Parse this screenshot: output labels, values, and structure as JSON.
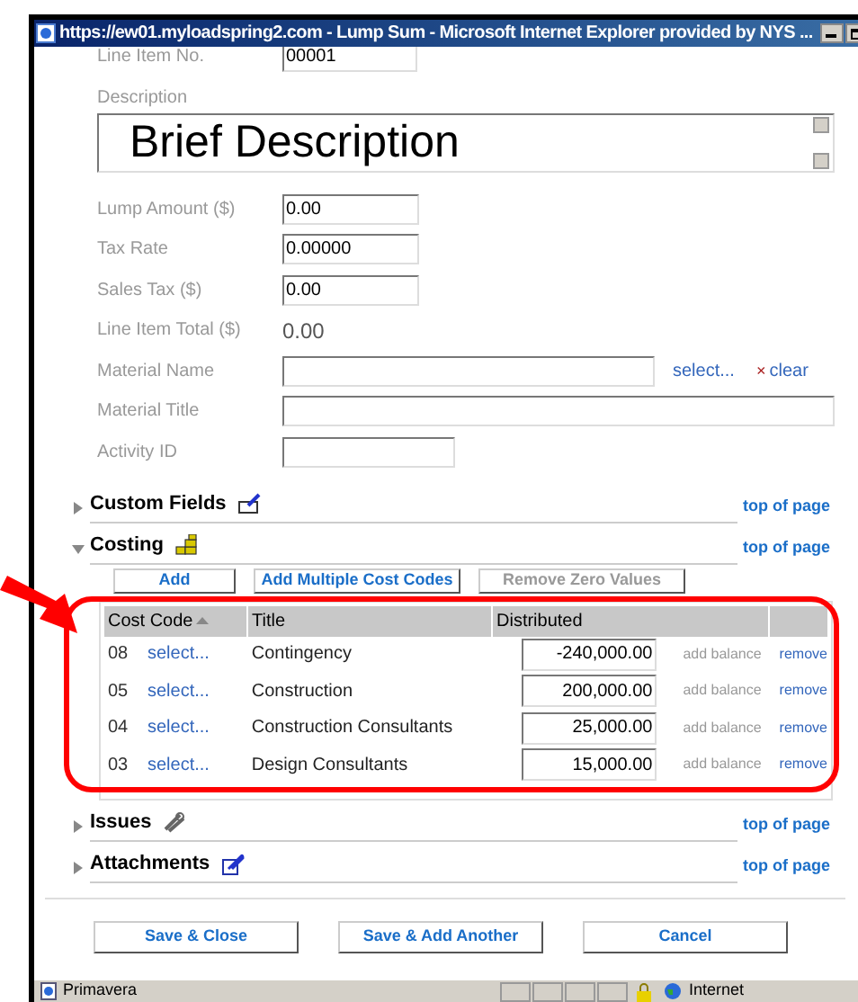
{
  "window": {
    "title": "https://ew01.myloadspring2.com - Lump Sum - Microsoft Internet Explorer provided by NYS ..."
  },
  "line_item": {
    "label": "Line Item No.",
    "value": "00001"
  },
  "description": {
    "label": "Description",
    "value": "Brief Description"
  },
  "fields": [
    {
      "kind": "input",
      "label": "Lump Amount ($)",
      "value": "0.00"
    },
    {
      "kind": "input",
      "label": "Tax Rate",
      "value": "0.00000"
    },
    {
      "kind": "input",
      "label": "Sales Tax ($)",
      "value": "0.00"
    },
    {
      "kind": "text",
      "label": "Line Item Total ($)",
      "value": "0.00"
    },
    {
      "kind": "lookup",
      "label": "Material Name",
      "select": "select...",
      "clear_icon": "×",
      "clear": "clear"
    },
    {
      "kind": "input",
      "label": "Material Title"
    },
    {
      "kind": "input",
      "label": "Activity ID"
    }
  ],
  "sections": [
    {
      "title": "Custom Fields",
      "expanded": false,
      "link": "top of page"
    },
    {
      "title": "Costing",
      "expanded": true,
      "link": "top of page"
    },
    {
      "title": "Issues",
      "expanded": false,
      "link": "top of page"
    },
    {
      "title": "Attachments",
      "expanded": false,
      "link": "top of page"
    }
  ],
  "costing": {
    "buttons": [
      {
        "label": "Add",
        "disabled": false
      },
      {
        "label": "Add Multiple Cost Codes",
        "disabled": false
      },
      {
        "label": "Remove Zero Values",
        "disabled": true
      }
    ],
    "columns": [
      {
        "label": "Cost Code",
        "sorted": true
      },
      {
        "label": "Title",
        "sorted": false
      },
      {
        "label": "Distributed",
        "sorted": false
      }
    ],
    "rows": [
      {
        "code": "08",
        "select": "select...",
        "title": "Contingency",
        "distributed": "-240,000.00",
        "add_balance": "add balance",
        "remove": "remove"
      },
      {
        "code": "05",
        "select": "select...",
        "title": "Construction",
        "distributed": "200,000.00",
        "add_balance": "add balance",
        "remove": "remove"
      },
      {
        "code": "04",
        "select": "select...",
        "title": "Construction Consultants",
        "distributed": "25,000.00",
        "add_balance": "add balance",
        "remove": "remove"
      },
      {
        "code": "03",
        "select": "select...",
        "title": "Design Consultants",
        "distributed": "15,000.00",
        "add_balance": "add balance",
        "remove": "remove"
      }
    ]
  },
  "footer_buttons": [
    "Save & Close",
    "Save & Add Another",
    "Cancel"
  ],
  "status_bar": {
    "left": "Primavera",
    "zone": "Internet"
  }
}
